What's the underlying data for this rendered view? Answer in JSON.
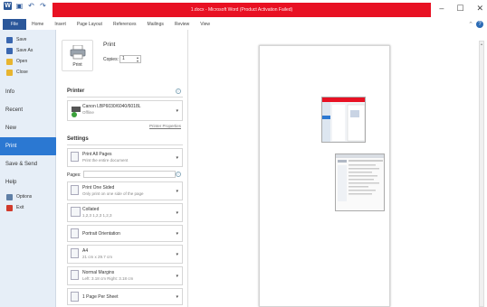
{
  "window": {
    "title": "1.docx - Microsoft Word (Product Activation Failed)",
    "controls": [
      "–",
      "☐",
      "✕"
    ]
  },
  "quick_access": [
    "W",
    "💾",
    "↶",
    "↷"
  ],
  "ribbon": {
    "tabs": [
      "File",
      "Home",
      "Insert",
      "Page Layout",
      "References",
      "Mailings",
      "Review",
      "View"
    ]
  },
  "backstage_nav": {
    "small_items": [
      {
        "label": "Save",
        "icon": "save-icon",
        "color": "#3a67b0"
      },
      {
        "label": "Save As",
        "icon": "save-as-icon",
        "color": "#3a67b0"
      },
      {
        "label": "Open",
        "icon": "open-folder-icon",
        "color": "#e8b530"
      },
      {
        "label": "Close",
        "icon": "close-folder-icon",
        "color": "#e8b530"
      }
    ],
    "big_items": [
      "Info",
      "Recent",
      "New",
      "Print",
      "Save & Send",
      "Help"
    ],
    "bottom_items": [
      {
        "label": "Options",
        "icon": "options-icon",
        "color": "#5f7fa6"
      },
      {
        "label": "Exit",
        "icon": "exit-icon",
        "color": "#d13a2c"
      }
    ],
    "active": "Print"
  },
  "print_panel": {
    "heading": "Print",
    "print_button_label": "Print",
    "copies_label": "Copies:",
    "copies_value": "1",
    "printer_section": "Printer",
    "printer_name": "Canon LBP6030/6040/6018L",
    "printer_status": "Offline",
    "printer_properties_link": "Printer Properties",
    "settings_section": "Settings",
    "pages_label": "Pages:",
    "settings": [
      {
        "main": "Print All Pages",
        "sub": "Print the entire document"
      },
      {
        "main": "Print One Sided",
        "sub": "Only print on one side of the page"
      },
      {
        "main": "Collated",
        "sub": "1,2,3    1,2,3    1,2,3"
      },
      {
        "main": "Portrait Orientation",
        "sub": ""
      },
      {
        "main": "A4",
        "sub": "21 cm x 29.7 cm"
      },
      {
        "main": "Normal Margins",
        "sub": "Left:  3.18 cm    Right:  3.18 cm"
      },
      {
        "main": "1 Page Per Sheet",
        "sub": ""
      }
    ]
  },
  "accent": {
    "file_tab": "#2b579a",
    "active_nav": "#2b78d2",
    "title_red": "#e81123"
  }
}
